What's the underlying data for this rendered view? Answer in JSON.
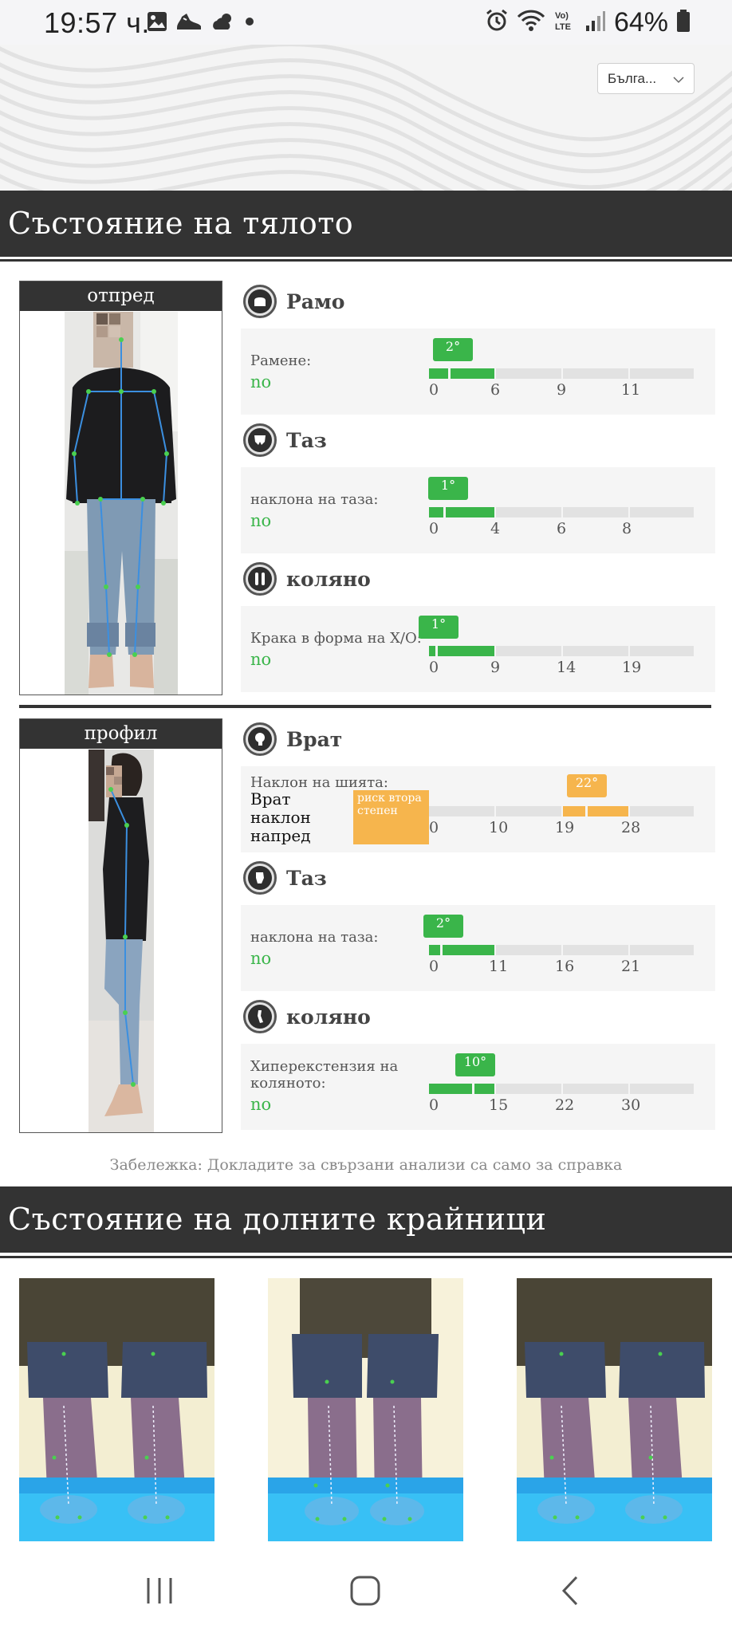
{
  "status_bar": {
    "time": "19:57 ч.",
    "battery": "64%",
    "icons": [
      "image-icon",
      "shoe-icon",
      "weather-icon",
      "dot-icon",
      "alarm-icon",
      "wifi-icon",
      "volte-icon",
      "signal-icon",
      "battery-icon"
    ]
  },
  "header": {
    "language_select": "Бълга..."
  },
  "sections": {
    "body": "Състояние на тялото",
    "lower": "Състояние на долните крайници"
  },
  "photos": {
    "front": "отпред",
    "profile": "профил"
  },
  "front": {
    "shoulder": {
      "title": "Рамо",
      "label": "Рамене:",
      "status": "no",
      "value": "2°",
      "value_num": 2,
      "ticks": [
        "0",
        "6",
        "9",
        "11"
      ],
      "color": "#3ab54a"
    },
    "pelvis": {
      "title": "Таз",
      "label": "наклона на таза:",
      "status": "no",
      "value": "1°",
      "value_num": 1,
      "ticks": [
        "0",
        "4",
        "6",
        "8"
      ],
      "color": "#3ab54a"
    },
    "knee": {
      "title": "коляно",
      "label": "Крака в форма на X/O:",
      "status": "no",
      "value": "1°",
      "value_num": 1,
      "ticks": [
        "0",
        "9",
        "14",
        "19"
      ],
      "color": "#3ab54a"
    }
  },
  "profile": {
    "neck": {
      "title": "Врат",
      "label": "Наклон на шията:",
      "status_multiline": "Врат наклон напред",
      "risk_label": "риск втора степен",
      "value": "22°",
      "value_num": 22,
      "ticks": [
        "0",
        "10",
        "19",
        "28"
      ],
      "color": "#f6b54d"
    },
    "pelvis": {
      "title": "Таз",
      "label": "наклона на таза:",
      "status": "no",
      "value": "2°",
      "value_num": 2,
      "ticks": [
        "0",
        "11",
        "16",
        "21"
      ],
      "color": "#3ab54a"
    },
    "knee": {
      "title": "коляно",
      "label": "Хиперекстензия на коляното:",
      "status": "no",
      "value": "10°",
      "value_num": 10,
      "ticks": [
        "0",
        "15",
        "22",
        "30"
      ],
      "color": "#3ab54a"
    }
  },
  "note": "Забележка: Докладите за свързани анализи са само за справка"
}
